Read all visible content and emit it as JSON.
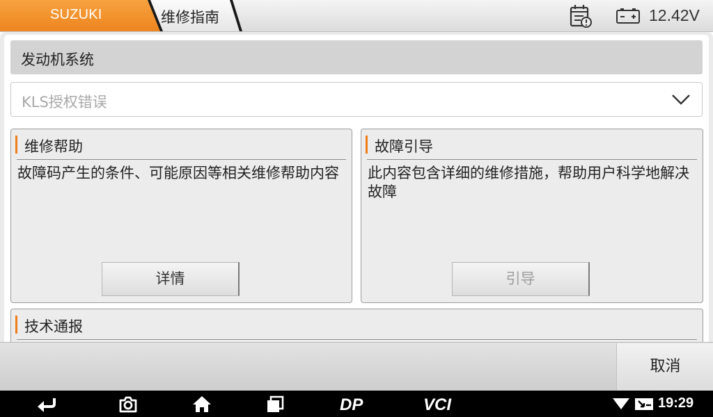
{
  "header": {
    "make_tab": "SUZUKI",
    "guide_tab": "维修指南",
    "voltage": "12.42V",
    "icons": [
      "calendar-alert-icon",
      "battery-icon"
    ]
  },
  "system": {
    "title": "发动机系统",
    "fault_select": "KLS授权错误"
  },
  "panels": {
    "help": {
      "title": "维修帮助",
      "description": "故障码产生的条件、可能原因等相关维修帮助内容",
      "button": "详情"
    },
    "guide": {
      "title": "故障引导",
      "description": "此内容包含详细的维修措施，帮助用户科学地解决故障",
      "button": "引导"
    },
    "bulletin": {
      "title": "技术通报"
    }
  },
  "footer": {
    "cancel": "取消"
  },
  "navbar": {
    "time": "19:29",
    "dp_label": "DP",
    "vci_label": "VCI"
  },
  "colors": {
    "accent": "#ee8520",
    "accent_bar": "#ee7d1a"
  }
}
